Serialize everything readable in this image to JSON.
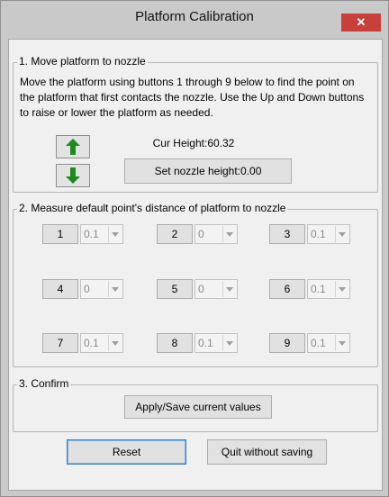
{
  "window": {
    "title": "Platform Calibration",
    "close_glyph": "✕"
  },
  "section1": {
    "title": "1. Move platform to nozzle",
    "description": "Move the platform using buttons 1 through 9 below to find the point on the platform that first contacts the nozzle. Use the Up and Down buttons to raise or lower the platform as needed.",
    "up_icon": "arrow-up-icon",
    "down_icon": "arrow-down-icon",
    "cur_height": "Cur Height:60.32",
    "set_nozzle_label": "Set nozzle height:0.00"
  },
  "section2": {
    "title": "2. Measure default point's distance of platform to nozzle",
    "points": [
      {
        "label": "1",
        "value": "0.1"
      },
      {
        "label": "2",
        "value": "0"
      },
      {
        "label": "3",
        "value": "0.1"
      },
      {
        "label": "4",
        "value": "0"
      },
      {
        "label": "5",
        "value": "0"
      },
      {
        "label": "6",
        "value": "0.1"
      },
      {
        "label": "7",
        "value": "0.1"
      },
      {
        "label": "8",
        "value": "0.1"
      },
      {
        "label": "9",
        "value": "0.1"
      }
    ]
  },
  "section3": {
    "title": "3. Confirm",
    "apply_label": "Apply/Save current values"
  },
  "footer": {
    "reset_label": "Reset",
    "quit_label": "Quit without saving"
  },
  "colors": {
    "arrow_green": "#1f8a1f",
    "close_red": "#c8403b"
  }
}
